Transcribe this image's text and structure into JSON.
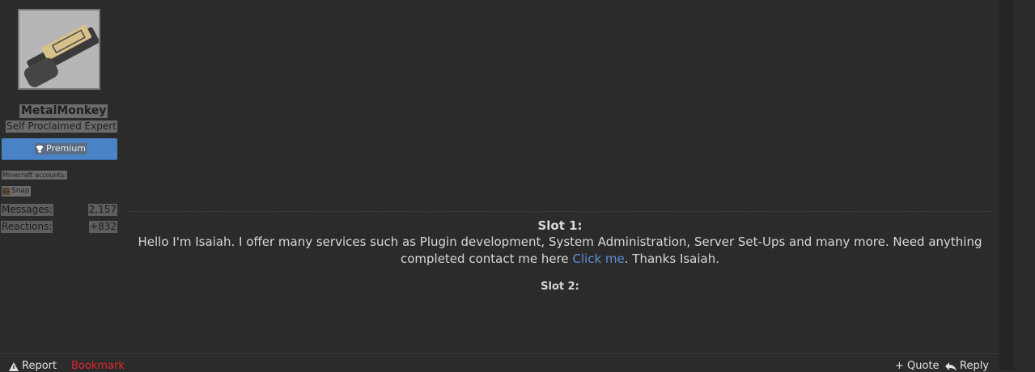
{
  "sidebar": {
    "username": "MetalMonkey",
    "user_title": "Self Proclaimed Expert",
    "premium_label": "Premium",
    "minecraft_label": "Minecraft accounts:",
    "minecraft_account": "Snap",
    "stats": {
      "messages_label": "Messages:",
      "messages_value": "2,157",
      "reactions_label": "Reactions:",
      "reactions_value": "+832"
    }
  },
  "signature": {
    "slot1_title": "Slot 1:",
    "slot1_text_before": "Hello I'm Isaiah. I offer many services such as Plugin development, System Administration, Server Set-Ups and many more. Need anything completed contact me here ",
    "slot1_link": "Click me",
    "slot1_text_after": ". Thanks Isaiah.",
    "slot2_title": "Slot 2:"
  },
  "footer": {
    "report_label": "Report",
    "bookmark_label": "Bookmark",
    "quote_label": "+ Quote",
    "reply_label": "Reply"
  },
  "colors": {
    "background": "#2b2b2b",
    "premium": "#4a82c6",
    "link": "#5a8fd4",
    "bookmark": "#e0282d",
    "corner_accent": "#7cc242"
  }
}
